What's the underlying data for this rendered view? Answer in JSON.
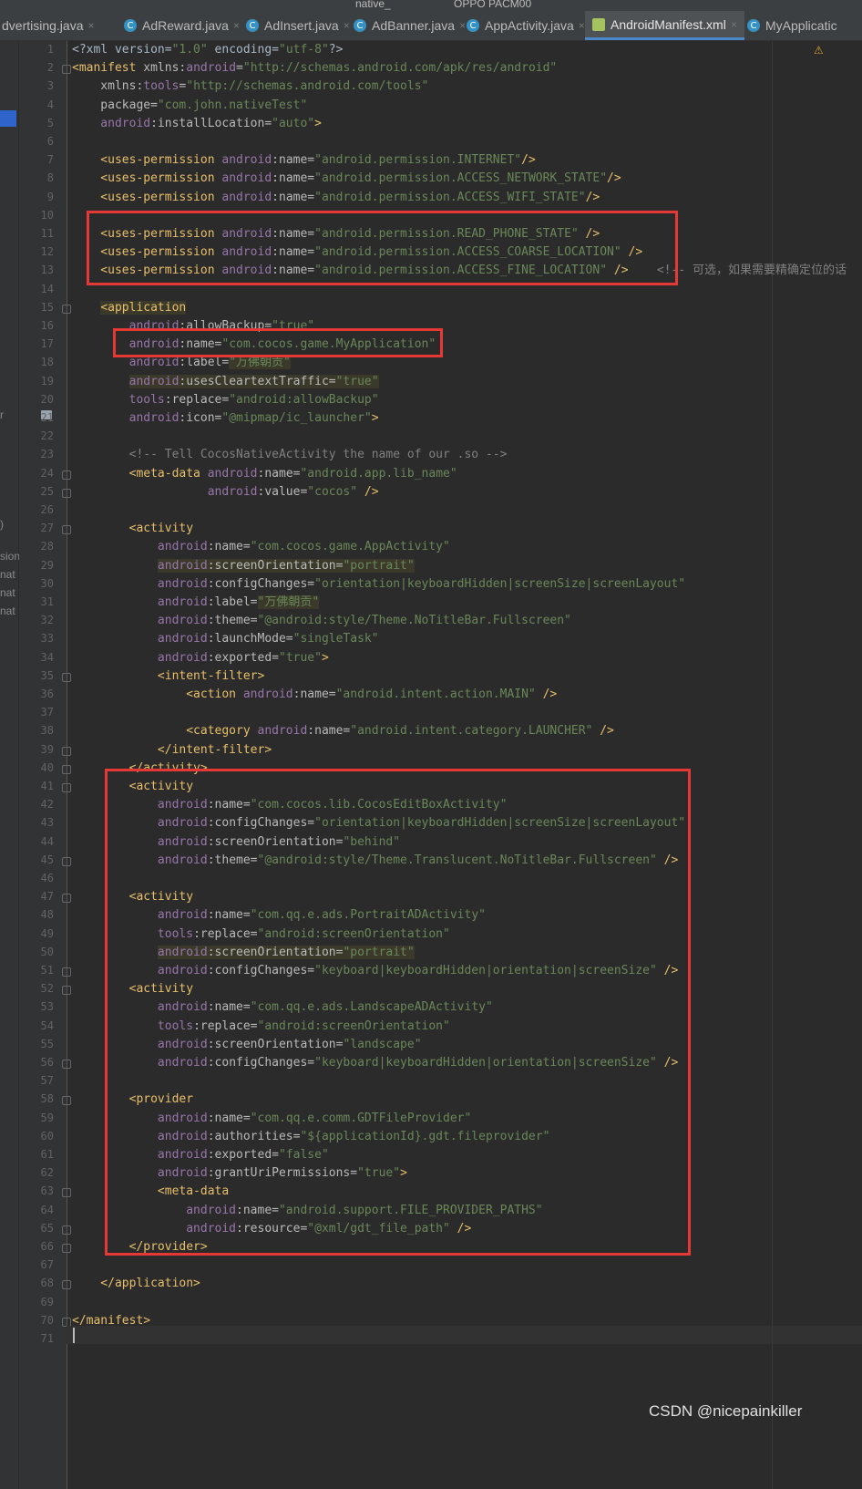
{
  "toolbar": {
    "run_config": "native_",
    "device": "OPPO PACM00"
  },
  "tabs": [
    {
      "label": "dvertising.java",
      "icon": "java-class-icon",
      "active": false
    },
    {
      "label": "AdReward.java",
      "icon": "java-class-icon",
      "active": false
    },
    {
      "label": "AdInsert.java",
      "icon": "java-class-icon",
      "active": false
    },
    {
      "label": "AdBanner.java",
      "icon": "java-class-icon",
      "active": false
    },
    {
      "label": "AppActivity.java",
      "icon": "java-class-icon",
      "active": false
    },
    {
      "label": "AndroidManifest.xml",
      "icon": "manifest-file-icon",
      "active": true
    },
    {
      "label": "MyApplicatic",
      "icon": "java-class-icon",
      "active": false
    }
  ],
  "left_strip": [
    "r",
    ")",
    "sion",
    "nat",
    "nat",
    "nat"
  ],
  "line_numbers": [
    "1",
    "2",
    "3",
    "4",
    "5",
    "6",
    "7",
    "8",
    "9",
    "10",
    "11",
    "12",
    "13",
    "14",
    "15",
    "16",
    "17",
    "18",
    "19",
    "20",
    "21",
    "22",
    "23",
    "24",
    "25",
    "26",
    "27",
    "28",
    "29",
    "30",
    "31",
    "32",
    "33",
    "34",
    "35",
    "36",
    "37",
    "38",
    "39",
    "40",
    "41",
    "42",
    "43",
    "44",
    "45",
    "46",
    "47",
    "48",
    "49",
    "50",
    "51",
    "52",
    "53",
    "54",
    "55",
    "56",
    "57",
    "58",
    "59",
    "60",
    "61",
    "62",
    "63",
    "64",
    "65",
    "66",
    "67",
    "68",
    "69",
    "70",
    "71"
  ],
  "code_lines": [
    [
      [
        "pl",
        "<?xml version="
      ],
      [
        "vl",
        "\"1.0\""
      ],
      [
        "pl",
        " encoding="
      ],
      [
        "vl",
        "\"utf-8\""
      ],
      [
        "pl",
        "?>"
      ]
    ],
    [
      [
        "tg",
        "<manifest "
      ],
      [
        "at",
        "xmlns:"
      ],
      [
        "ns",
        "android"
      ],
      [
        "at",
        "="
      ],
      [
        "vl",
        "\"http://schemas.android.com/apk/res/android\""
      ]
    ],
    [
      [
        "at",
        "    xmlns:"
      ],
      [
        "ns",
        "tools"
      ],
      [
        "at",
        "="
      ],
      [
        "vl",
        "\"http://schemas.android.com/tools\""
      ]
    ],
    [
      [
        "at",
        "    package="
      ],
      [
        "vl",
        "\"com.john.nativeTest\""
      ]
    ],
    [
      [
        "ns",
        "    android"
      ],
      [
        "at",
        ":installLocation="
      ],
      [
        "vl",
        "\"auto\""
      ],
      [
        "tg",
        ">"
      ]
    ],
    [],
    [
      [
        "tg",
        "    <uses-permission "
      ],
      [
        "ns",
        "android"
      ],
      [
        "at",
        ":name="
      ],
      [
        "vl",
        "\"android.permission.INTERNET\""
      ],
      [
        "tg",
        "/>"
      ]
    ],
    [
      [
        "tg",
        "    <uses-permission "
      ],
      [
        "ns",
        "android"
      ],
      [
        "at",
        ":name="
      ],
      [
        "vl",
        "\"android.permission.ACCESS_NETWORK_STATE\""
      ],
      [
        "tg",
        "/>"
      ]
    ],
    [
      [
        "tg",
        "    <uses-permission "
      ],
      [
        "ns",
        "android"
      ],
      [
        "at",
        ":name="
      ],
      [
        "vl",
        "\"android.permission.ACCESS_WIFI_STATE\""
      ],
      [
        "tg",
        "/>"
      ]
    ],
    [],
    [
      [
        "tg",
        "    <uses-permission "
      ],
      [
        "ns",
        "android"
      ],
      [
        "at",
        ":name="
      ],
      [
        "vl",
        "\"android.permission.READ_PHONE_STATE\""
      ],
      [
        "tg",
        " />"
      ]
    ],
    [
      [
        "tg",
        "    <uses-permission "
      ],
      [
        "ns",
        "android"
      ],
      [
        "at",
        ":name="
      ],
      [
        "vl",
        "\"android.permission.ACCESS_COARSE_LOCATION\""
      ],
      [
        "tg",
        " />"
      ]
    ],
    [
      [
        "tg",
        "    <uses-permission "
      ],
      [
        "ns",
        "android"
      ],
      [
        "at",
        ":name="
      ],
      [
        "vl",
        "\"android.permission.ACCESS_FINE_LOCATION\""
      ],
      [
        "tg",
        " />"
      ],
      [
        "cm",
        "    <!-- 可选，如果需要精确定位的话"
      ]
    ],
    [],
    [
      [
        "pl",
        "    "
      ],
      [
        "tg hl",
        "<application"
      ]
    ],
    [
      [
        "ns",
        "        android"
      ],
      [
        "at",
        ":allowBackup="
      ],
      [
        "vl",
        "\"true\""
      ]
    ],
    [
      [
        "ns",
        "        android"
      ],
      [
        "at",
        ":name="
      ],
      [
        "vl",
        "\"com.cocos.game.MyApplication\""
      ]
    ],
    [
      [
        "ns",
        "        android"
      ],
      [
        "at",
        ":label="
      ],
      [
        "vl hl",
        "\"万佛朝贡\""
      ]
    ],
    [
      [
        "pl",
        "        "
      ],
      [
        "ns hl",
        "android"
      ],
      [
        "at hl",
        ":usesCleartextTraffic="
      ],
      [
        "vl hl",
        "\"true\""
      ]
    ],
    [
      [
        "ns",
        "        tools"
      ],
      [
        "at",
        ":replace="
      ],
      [
        "vl",
        "\"android:allowBackup\""
      ]
    ],
    [
      [
        "ns",
        "        android"
      ],
      [
        "at",
        ":icon="
      ],
      [
        "vl",
        "\"@mipmap/ic_launcher\""
      ],
      [
        "tg",
        ">"
      ]
    ],
    [],
    [
      [
        "cm",
        "        <!-- Tell CocosNativeActivity the name of our .so -->"
      ]
    ],
    [
      [
        "tg",
        "        <meta-data "
      ],
      [
        "ns",
        "android"
      ],
      [
        "at",
        ":name="
      ],
      [
        "vl",
        "\"android.app.lib_name\""
      ]
    ],
    [
      [
        "ns",
        "                   android"
      ],
      [
        "at",
        ":value="
      ],
      [
        "vl",
        "\"cocos\""
      ],
      [
        "tg",
        " />"
      ]
    ],
    [],
    [
      [
        "tg",
        "        <activity"
      ]
    ],
    [
      [
        "ns",
        "            android"
      ],
      [
        "at",
        ":name="
      ],
      [
        "vl",
        "\"com.cocos.game.AppActivity\""
      ]
    ],
    [
      [
        "pl",
        "            "
      ],
      [
        "ns hl",
        "android"
      ],
      [
        "at hl",
        ":screenOrientation="
      ],
      [
        "vl hl",
        "\"portrait\""
      ]
    ],
    [
      [
        "ns",
        "            android"
      ],
      [
        "at",
        ":configChanges="
      ],
      [
        "vl",
        "\"orientation|keyboardHidden|screenSize|screenLayout\""
      ]
    ],
    [
      [
        "ns",
        "            android"
      ],
      [
        "at",
        ":label="
      ],
      [
        "vl hl",
        "\"万佛朝贡\""
      ]
    ],
    [
      [
        "ns",
        "            android"
      ],
      [
        "at",
        ":theme="
      ],
      [
        "vl",
        "\"@android:style/Theme.NoTitleBar.Fullscreen\""
      ]
    ],
    [
      [
        "ns",
        "            android"
      ],
      [
        "at",
        ":launchMode="
      ],
      [
        "vl",
        "\"singleTask\""
      ]
    ],
    [
      [
        "ns",
        "            android"
      ],
      [
        "at",
        ":exported="
      ],
      [
        "vl",
        "\"true\""
      ],
      [
        "tg",
        ">"
      ]
    ],
    [
      [
        "tg",
        "            <intent-filter>"
      ]
    ],
    [
      [
        "tg",
        "                <action "
      ],
      [
        "ns",
        "android"
      ],
      [
        "at",
        ":name="
      ],
      [
        "vl",
        "\"android.intent.action.MAIN\""
      ],
      [
        "tg",
        " />"
      ]
    ],
    [],
    [
      [
        "tg",
        "                <category "
      ],
      [
        "ns",
        "android"
      ],
      [
        "at",
        ":name="
      ],
      [
        "vl",
        "\"android.intent.category.LAUNCHER\""
      ],
      [
        "tg",
        " />"
      ]
    ],
    [
      [
        "tg",
        "            </intent-filter>"
      ]
    ],
    [
      [
        "tg",
        "        </activity>"
      ]
    ],
    [
      [
        "tg",
        "        <activity"
      ]
    ],
    [
      [
        "ns",
        "            android"
      ],
      [
        "at",
        ":name="
      ],
      [
        "vl",
        "\"com.cocos.lib.CocosEditBoxActivity\""
      ]
    ],
    [
      [
        "ns",
        "            android"
      ],
      [
        "at",
        ":configChanges="
      ],
      [
        "vl",
        "\"orientation|keyboardHidden|screenSize|screenLayout\""
      ]
    ],
    [
      [
        "ns",
        "            android"
      ],
      [
        "at",
        ":screenOrientation="
      ],
      [
        "vl",
        "\"behind\""
      ]
    ],
    [
      [
        "ns",
        "            android"
      ],
      [
        "at",
        ":theme="
      ],
      [
        "vl",
        "\"@android:style/Theme.Translucent.NoTitleBar.Fullscreen\""
      ],
      [
        "tg",
        " />"
      ]
    ],
    [],
    [
      [
        "tg",
        "        <activity"
      ]
    ],
    [
      [
        "ns",
        "            android"
      ],
      [
        "at",
        ":name="
      ],
      [
        "vl",
        "\"com.qq.e.ads.PortraitADActivity\""
      ]
    ],
    [
      [
        "ns",
        "            tools"
      ],
      [
        "at",
        ":replace="
      ],
      [
        "vl",
        "\"android:screenOrientation\""
      ]
    ],
    [
      [
        "pl",
        "            "
      ],
      [
        "ns hl",
        "android"
      ],
      [
        "at hl",
        ":screenOrientation="
      ],
      [
        "vl hl",
        "\"portrait\""
      ]
    ],
    [
      [
        "ns",
        "            android"
      ],
      [
        "at",
        ":configChanges="
      ],
      [
        "vl",
        "\"keyboard|keyboardHidden|orientation|screenSize\""
      ],
      [
        "tg",
        " />"
      ]
    ],
    [
      [
        "tg",
        "        <activity"
      ]
    ],
    [
      [
        "ns",
        "            android"
      ],
      [
        "at",
        ":name="
      ],
      [
        "vl",
        "\"com.qq.e.ads.LandscapeADActivity\""
      ]
    ],
    [
      [
        "ns",
        "            tools"
      ],
      [
        "at",
        ":replace="
      ],
      [
        "vl",
        "\"android:screenOrientation\""
      ]
    ],
    [
      [
        "ns",
        "            android"
      ],
      [
        "at",
        ":screenOrientation="
      ],
      [
        "vl",
        "\"landscape\""
      ]
    ],
    [
      [
        "ns",
        "            android"
      ],
      [
        "at",
        ":configChanges="
      ],
      [
        "vl",
        "\"keyboard|keyboardHidden|orientation|screenSize\""
      ],
      [
        "tg",
        " />"
      ]
    ],
    [],
    [
      [
        "tg",
        "        <provider"
      ]
    ],
    [
      [
        "ns",
        "            android"
      ],
      [
        "at",
        ":name="
      ],
      [
        "vl",
        "\"com.qq.e.comm.GDTFileProvider\""
      ]
    ],
    [
      [
        "ns",
        "            android"
      ],
      [
        "at",
        ":authorities="
      ],
      [
        "vl",
        "\"${applicationId}.gdt.fileprovider\""
      ]
    ],
    [
      [
        "ns",
        "            android"
      ],
      [
        "at",
        ":exported="
      ],
      [
        "vl",
        "\"false\""
      ]
    ],
    [
      [
        "ns",
        "            android"
      ],
      [
        "at",
        ":grantUriPermissions="
      ],
      [
        "vl",
        "\"true\""
      ],
      [
        "tg",
        ">"
      ]
    ],
    [
      [
        "tg",
        "            <meta-data"
      ]
    ],
    [
      [
        "ns",
        "                android"
      ],
      [
        "at",
        ":name="
      ],
      [
        "vl",
        "\"android.support.FILE_PROVIDER_PATHS\""
      ]
    ],
    [
      [
        "ns",
        "                android"
      ],
      [
        "at",
        ":resource="
      ],
      [
        "vl",
        "\"@xml/gdt_file_path\""
      ],
      [
        "tg",
        " />"
      ]
    ],
    [
      [
        "tg",
        "        </provider>"
      ]
    ],
    [],
    [
      [
        "tg",
        "    </application>"
      ]
    ],
    [],
    [
      [
        "tg",
        "</manifest>"
      ]
    ],
    []
  ],
  "watermark": "CSDN @nicepainkiller"
}
